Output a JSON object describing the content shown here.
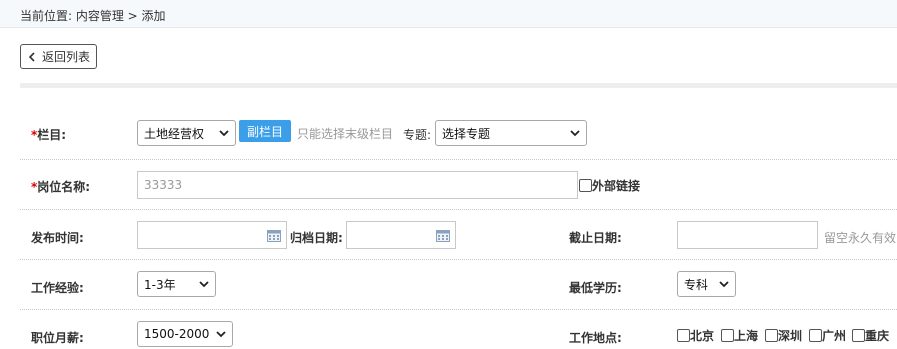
{
  "breadcrumb": {
    "text": "当前位置: 内容管理 > 添加"
  },
  "back_button": {
    "label": "返回列表"
  },
  "form": {
    "column": {
      "required_mark": "*",
      "label": "栏目:",
      "selected": "土地经营权",
      "sub_button": "副栏目",
      "hint": "只能选择末级栏目",
      "topic_label": "专题:",
      "topic_selected": "选择专题"
    },
    "position_name": {
      "required_mark": "*",
      "label": "岗位名称:",
      "value": "33333",
      "external_link_label": "外部链接"
    },
    "dates": {
      "publish_label": "发布时间:",
      "archive_label": "归档日期:",
      "deadline_label": "截止日期:",
      "deadline_hint": "留空永久有效"
    },
    "experience": {
      "label": "工作经验:",
      "selected": "1-3年"
    },
    "education": {
      "label": "最低学历:",
      "selected": "专科"
    },
    "salary": {
      "label": "职位月薪:",
      "selected": "1500-2000"
    },
    "location": {
      "label": "工作地点:",
      "options": [
        "北京",
        "上海",
        "深圳",
        "广州",
        "重庆"
      ]
    }
  }
}
